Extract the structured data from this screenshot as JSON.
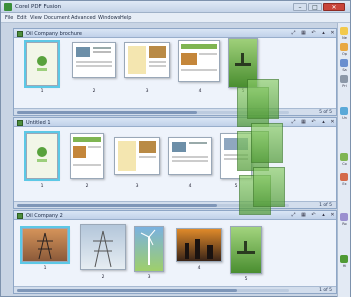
{
  "window": {
    "title": "Corel PDF Fusion",
    "controls": {
      "minimize": "–",
      "maximize": "□",
      "close": "✕"
    }
  },
  "menu": [
    "File",
    "Edit",
    "View",
    "Document",
    "Advanced",
    "Windows",
    "Help"
  ],
  "panels": [
    {
      "title": "Oil Company brochure",
      "page_count": "5 of 5",
      "pages": [
        "1",
        "2",
        "3",
        "4",
        "5"
      ]
    },
    {
      "title": "Untitled 1",
      "page_count": "1 of 5",
      "pages": [
        "1",
        "2",
        "3",
        "4",
        "5"
      ]
    },
    {
      "title": "Oil Company 2",
      "page_count": "1 of 5",
      "pages": [
        "1",
        "2",
        "3",
        "4",
        "5"
      ]
    }
  ],
  "right_toolbar": [
    "Ne",
    "Op",
    "Sa",
    "Pri",
    "Un",
    "Co",
    "Ex",
    "Ro",
    "Hi"
  ],
  "colors": {
    "accent": "#5cc8e6",
    "brand_green": "#4f9a34",
    "panel_bg": "#eef3fb"
  }
}
